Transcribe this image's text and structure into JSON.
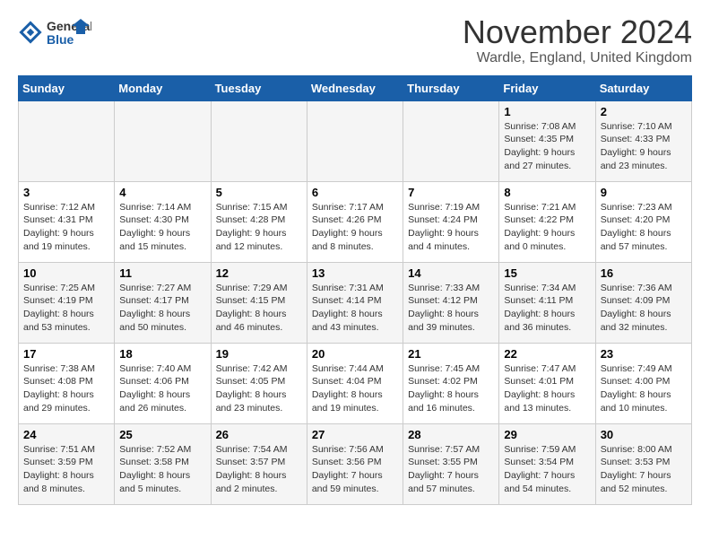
{
  "logo": {
    "line1": "General",
    "line2": "Blue"
  },
  "header": {
    "month": "November 2024",
    "location": "Wardle, England, United Kingdom"
  },
  "weekdays": [
    "Sunday",
    "Monday",
    "Tuesday",
    "Wednesday",
    "Thursday",
    "Friday",
    "Saturday"
  ],
  "weeks": [
    [
      {
        "day": "",
        "info": ""
      },
      {
        "day": "",
        "info": ""
      },
      {
        "day": "",
        "info": ""
      },
      {
        "day": "",
        "info": ""
      },
      {
        "day": "",
        "info": ""
      },
      {
        "day": "1",
        "info": "Sunrise: 7:08 AM\nSunset: 4:35 PM\nDaylight: 9 hours and 27 minutes."
      },
      {
        "day": "2",
        "info": "Sunrise: 7:10 AM\nSunset: 4:33 PM\nDaylight: 9 hours and 23 minutes."
      }
    ],
    [
      {
        "day": "3",
        "info": "Sunrise: 7:12 AM\nSunset: 4:31 PM\nDaylight: 9 hours and 19 minutes."
      },
      {
        "day": "4",
        "info": "Sunrise: 7:14 AM\nSunset: 4:30 PM\nDaylight: 9 hours and 15 minutes."
      },
      {
        "day": "5",
        "info": "Sunrise: 7:15 AM\nSunset: 4:28 PM\nDaylight: 9 hours and 12 minutes."
      },
      {
        "day": "6",
        "info": "Sunrise: 7:17 AM\nSunset: 4:26 PM\nDaylight: 9 hours and 8 minutes."
      },
      {
        "day": "7",
        "info": "Sunrise: 7:19 AM\nSunset: 4:24 PM\nDaylight: 9 hours and 4 minutes."
      },
      {
        "day": "8",
        "info": "Sunrise: 7:21 AM\nSunset: 4:22 PM\nDaylight: 9 hours and 0 minutes."
      },
      {
        "day": "9",
        "info": "Sunrise: 7:23 AM\nSunset: 4:20 PM\nDaylight: 8 hours and 57 minutes."
      }
    ],
    [
      {
        "day": "10",
        "info": "Sunrise: 7:25 AM\nSunset: 4:19 PM\nDaylight: 8 hours and 53 minutes."
      },
      {
        "day": "11",
        "info": "Sunrise: 7:27 AM\nSunset: 4:17 PM\nDaylight: 8 hours and 50 minutes."
      },
      {
        "day": "12",
        "info": "Sunrise: 7:29 AM\nSunset: 4:15 PM\nDaylight: 8 hours and 46 minutes."
      },
      {
        "day": "13",
        "info": "Sunrise: 7:31 AM\nSunset: 4:14 PM\nDaylight: 8 hours and 43 minutes."
      },
      {
        "day": "14",
        "info": "Sunrise: 7:33 AM\nSunset: 4:12 PM\nDaylight: 8 hours and 39 minutes."
      },
      {
        "day": "15",
        "info": "Sunrise: 7:34 AM\nSunset: 4:11 PM\nDaylight: 8 hours and 36 minutes."
      },
      {
        "day": "16",
        "info": "Sunrise: 7:36 AM\nSunset: 4:09 PM\nDaylight: 8 hours and 32 minutes."
      }
    ],
    [
      {
        "day": "17",
        "info": "Sunrise: 7:38 AM\nSunset: 4:08 PM\nDaylight: 8 hours and 29 minutes."
      },
      {
        "day": "18",
        "info": "Sunrise: 7:40 AM\nSunset: 4:06 PM\nDaylight: 8 hours and 26 minutes."
      },
      {
        "day": "19",
        "info": "Sunrise: 7:42 AM\nSunset: 4:05 PM\nDaylight: 8 hours and 23 minutes."
      },
      {
        "day": "20",
        "info": "Sunrise: 7:44 AM\nSunset: 4:04 PM\nDaylight: 8 hours and 19 minutes."
      },
      {
        "day": "21",
        "info": "Sunrise: 7:45 AM\nSunset: 4:02 PM\nDaylight: 8 hours and 16 minutes."
      },
      {
        "day": "22",
        "info": "Sunrise: 7:47 AM\nSunset: 4:01 PM\nDaylight: 8 hours and 13 minutes."
      },
      {
        "day": "23",
        "info": "Sunrise: 7:49 AM\nSunset: 4:00 PM\nDaylight: 8 hours and 10 minutes."
      }
    ],
    [
      {
        "day": "24",
        "info": "Sunrise: 7:51 AM\nSunset: 3:59 PM\nDaylight: 8 hours and 8 minutes."
      },
      {
        "day": "25",
        "info": "Sunrise: 7:52 AM\nSunset: 3:58 PM\nDaylight: 8 hours and 5 minutes."
      },
      {
        "day": "26",
        "info": "Sunrise: 7:54 AM\nSunset: 3:57 PM\nDaylight: 8 hours and 2 minutes."
      },
      {
        "day": "27",
        "info": "Sunrise: 7:56 AM\nSunset: 3:56 PM\nDaylight: 7 hours and 59 minutes."
      },
      {
        "day": "28",
        "info": "Sunrise: 7:57 AM\nSunset: 3:55 PM\nDaylight: 7 hours and 57 minutes."
      },
      {
        "day": "29",
        "info": "Sunrise: 7:59 AM\nSunset: 3:54 PM\nDaylight: 7 hours and 54 minutes."
      },
      {
        "day": "30",
        "info": "Sunrise: 8:00 AM\nSunset: 3:53 PM\nDaylight: 7 hours and 52 minutes."
      }
    ]
  ]
}
